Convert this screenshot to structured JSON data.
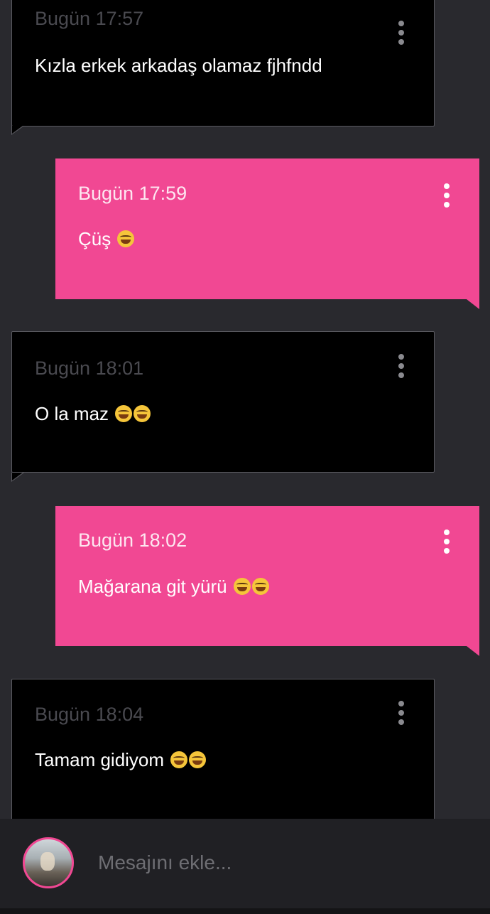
{
  "messages": [
    {
      "direction": "in",
      "time": "Bugün 17:57",
      "text": "Kızla erkek arkadaş olamaz fjhfndd",
      "emoji_count": 0
    },
    {
      "direction": "out",
      "time": "Bugün 17:59",
      "text": "Çüş",
      "emoji_count": 1
    },
    {
      "direction": "in",
      "time": "Bugün 18:01",
      "text": "O la maz",
      "emoji_count": 2
    },
    {
      "direction": "out",
      "time": "Bugün 18:02",
      "text": "Mağarana git yürü",
      "emoji_count": 2
    },
    {
      "direction": "in",
      "time": "Bugün 18:04",
      "text": "Tamam gidiyom",
      "emoji_count": 2
    }
  ],
  "emoji_icon": "face-with-tears-of-joy",
  "composer": {
    "placeholder": "Mesajını ekle..."
  },
  "colors": {
    "background": "#29292e",
    "incoming": "#000000",
    "outgoing": "#f14893"
  }
}
